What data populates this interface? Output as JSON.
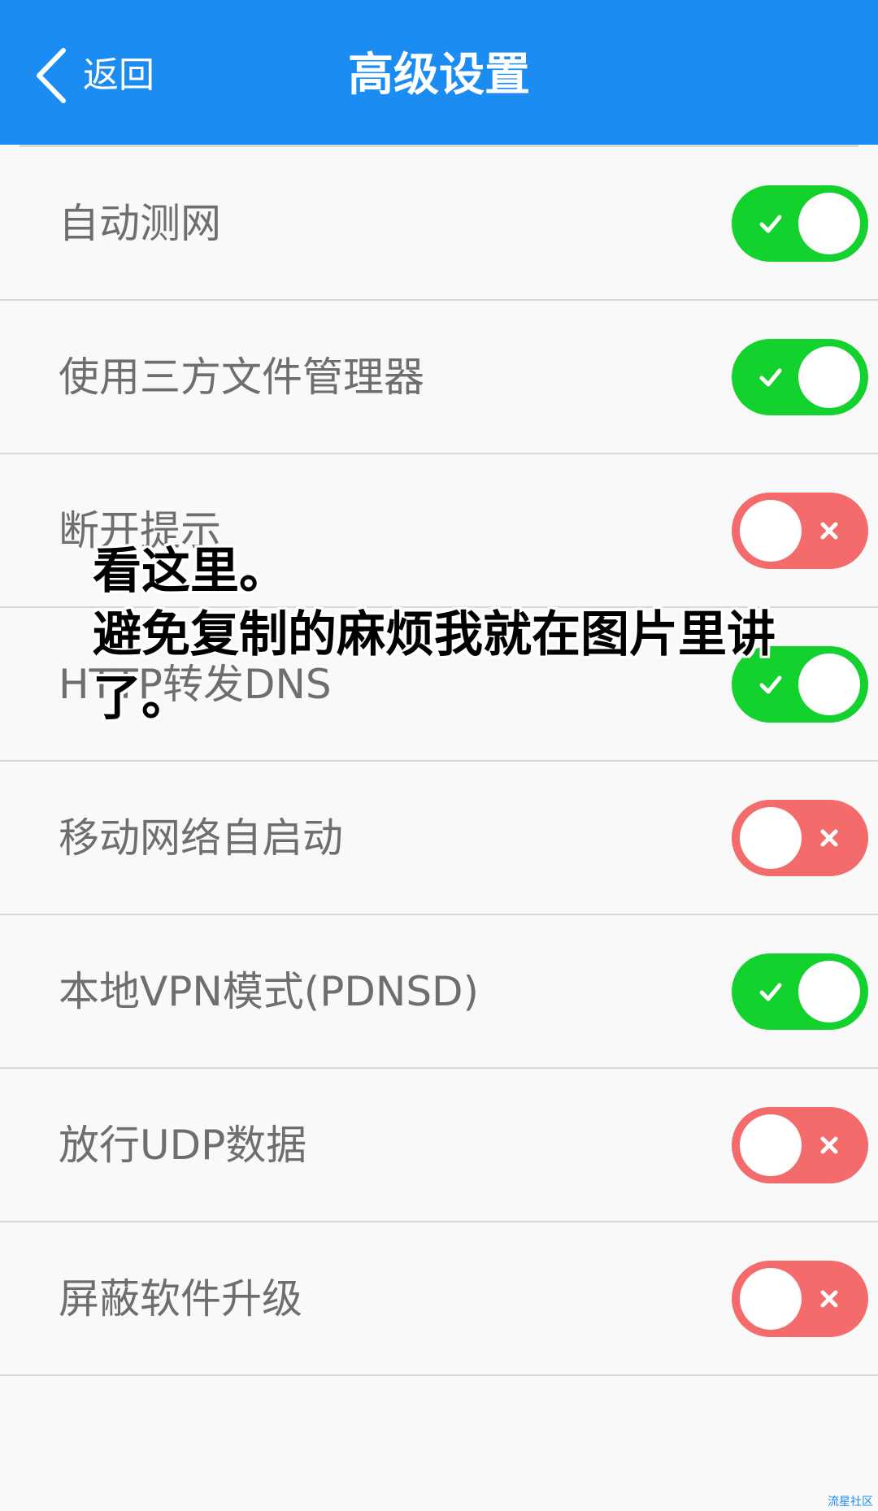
{
  "header": {
    "back_label": "返回",
    "title": "高级设置",
    "color": "#1a8cf2"
  },
  "settings": [
    {
      "label": "自动测网",
      "enabled": true
    },
    {
      "label": "使用三方文件管理器",
      "enabled": true
    },
    {
      "label": "断开提示",
      "enabled": false
    },
    {
      "label": "HTTP转发DNS",
      "enabled": true
    },
    {
      "label": "移动网络自启动",
      "enabled": false
    },
    {
      "label": "本地VPN模式(PDNSD)",
      "enabled": true
    },
    {
      "label": "放行UDP数据",
      "enabled": false
    },
    {
      "label": "屏蔽软件升级",
      "enabled": false
    }
  ],
  "overlay": {
    "lines": [
      "看这里。",
      "避免复制的麻烦我就在图片里讲",
      "了。"
    ]
  },
  "watermark": "流星社区",
  "colors": {
    "toggle_on": "#14d22e",
    "toggle_off": "#f36b6b",
    "label_text": "#6e6e6e"
  },
  "icons": {
    "back": "chevron-left-icon",
    "on_mark": "check-icon",
    "off_mark": "x-icon"
  }
}
